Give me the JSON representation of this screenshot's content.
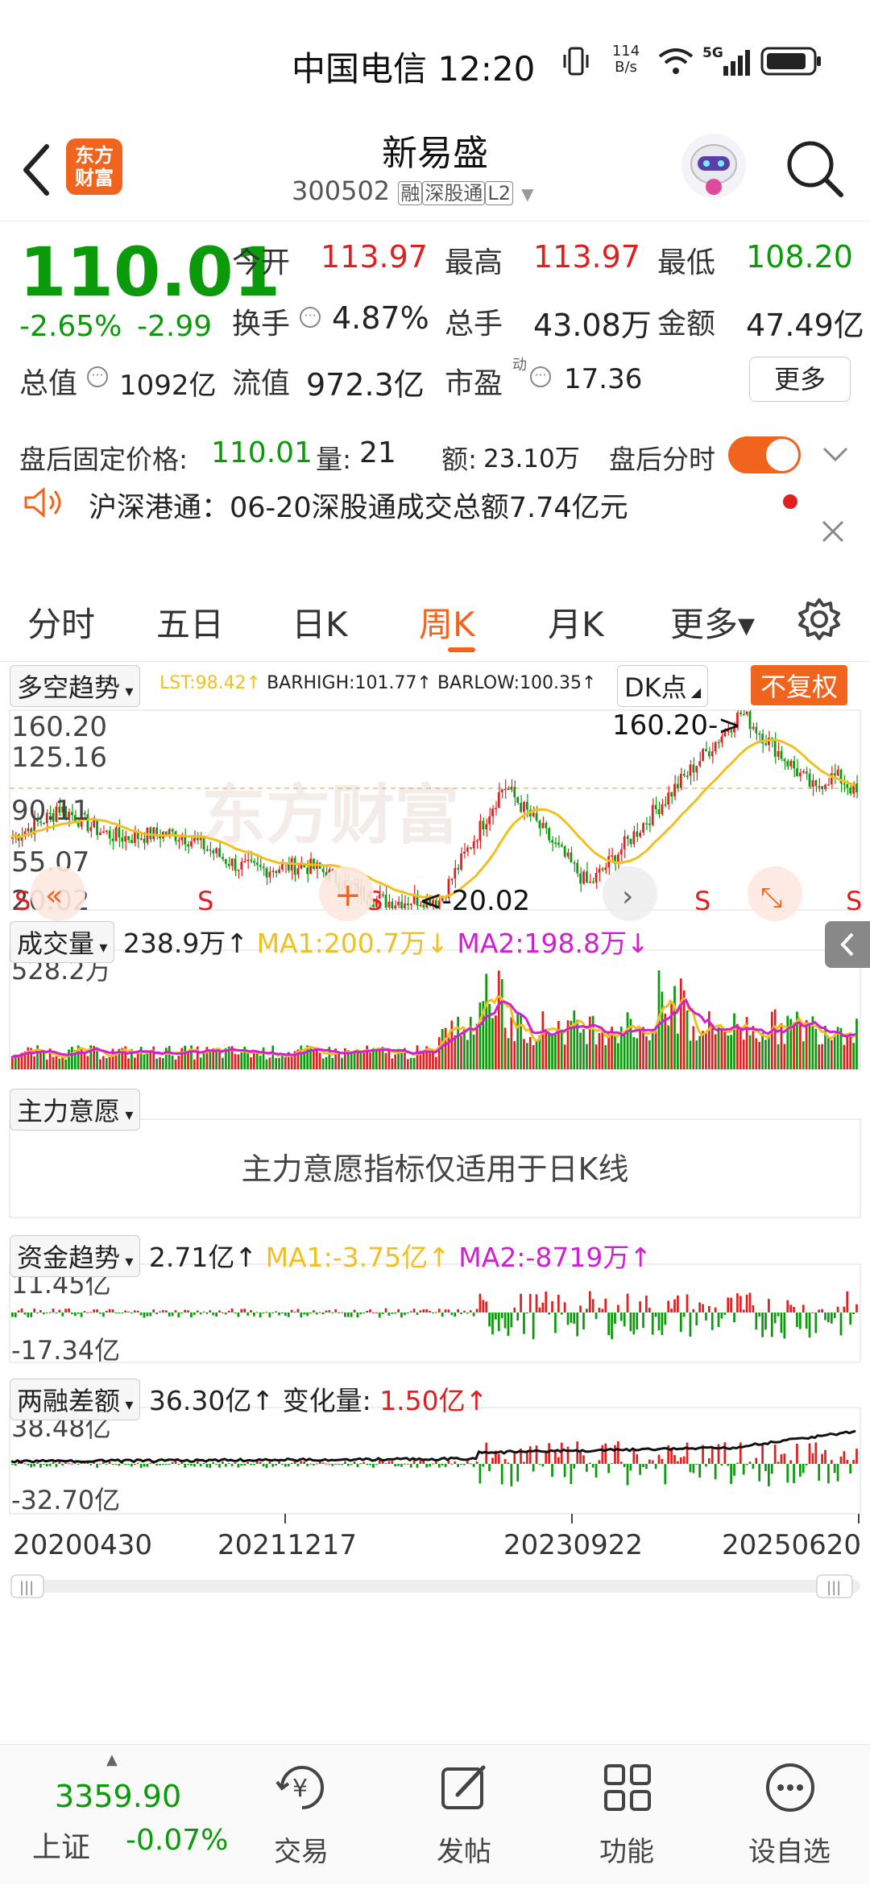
{
  "status_bar": {
    "carrier_time": "中国电信 12:20",
    "net_speed_value": "114",
    "net_speed_unit": "B/s",
    "net_type": "5G"
  },
  "header": {
    "logo_line1": "东方",
    "logo_line2": "财富",
    "title": "新易盛",
    "code": "300502",
    "tag_margin": "融",
    "tag_connect": "深股通",
    "tag_level": "L2"
  },
  "quote": {
    "price": "110.01",
    "change_pct": "-2.65%",
    "change_amt": "-2.99",
    "open_label": "今开",
    "open_value": "113.97",
    "high_label": "最高",
    "high_value": "113.97",
    "low_label": "最低",
    "low_value": "108.20",
    "turnover_label": "换手",
    "turnover_value": "4.87%",
    "volume_label": "总手",
    "volume_value": "43.08万",
    "amount_label": "金额",
    "amount_value": "47.49亿",
    "mktcap_label": "总值",
    "mktcap_value": "1092亿",
    "float_label": "流值",
    "float_value": "972.3亿",
    "pe_label": "市盈",
    "pe_sup": "动",
    "pe_value": "17.36",
    "more_button": "更多"
  },
  "after_hours": {
    "price_label": "盘后固定价格:",
    "price_value": "110.01",
    "vol_label": "量:",
    "vol_value": "21",
    "amt_label": "额:",
    "amt_value": "23.10万",
    "toggle_label": "盘后分时",
    "toggle_on": true
  },
  "notice": {
    "text": "沪深港通：06-20深股通成交总额7.74亿元"
  },
  "tabs": [
    {
      "label": "分时",
      "active": false
    },
    {
      "label": "五日",
      "active": false
    },
    {
      "label": "日K",
      "active": false
    },
    {
      "label": "周K",
      "active": true
    },
    {
      "label": "月K",
      "active": false
    },
    {
      "label": "更多▾",
      "active": false
    }
  ],
  "main_chart": {
    "indicator_select": "多空趋势",
    "lst": "LST:98.42",
    "barhigh": "BARHIGH:101.77",
    "barlow": "BARLOW:100.35",
    "dk_button": "DK点",
    "adjust_button": "不复权",
    "y_ticks": [
      "160.20",
      "125.16",
      "90.11",
      "55.07",
      "20.02"
    ],
    "max_label": "160.20->",
    "min_label": "<-20.02",
    "watermark": "东方财富",
    "signal": "S"
  },
  "volume": {
    "select": "成交量",
    "value": "238.9万",
    "ma1": "MA1:200.7万",
    "ma2": "MA2:198.8万",
    "y_top": "528.2万"
  },
  "main_force": {
    "select": "主力意愿",
    "message": "主力意愿指标仅适用于日K线"
  },
  "fund_trend": {
    "select": "资金趋势",
    "value": "2.71亿",
    "ma1": "MA1:-3.75亿",
    "ma2": "MA2:-8719万",
    "y_top": "11.45亿",
    "y_bottom": "-17.34亿"
  },
  "margin_diff": {
    "select": "两融差额",
    "value": "36.30亿",
    "change_label": "变化量:",
    "change_value": "1.50亿",
    "y_top": "38.48亿",
    "y_bottom": "-32.70亿"
  },
  "x_axis": [
    "20200430",
    "20211217",
    "20230922",
    "20250620"
  ],
  "colors": {
    "up": "#e02020",
    "down": "#0a9a0a",
    "accent": "#f0641e",
    "ma1": "#f0c020",
    "ma2": "#d020d0"
  },
  "bottom_bar": {
    "index_value": "3359.90",
    "index_name": "上证",
    "index_change": "-0.07%",
    "items": [
      {
        "label": "交易",
        "icon": "yen-trade-icon"
      },
      {
        "label": "发帖",
        "icon": "edit-post-icon"
      },
      {
        "label": "功能",
        "icon": "grid-apps-icon"
      },
      {
        "label": "设自选",
        "icon": "dots-circle-icon"
      }
    ]
  }
}
